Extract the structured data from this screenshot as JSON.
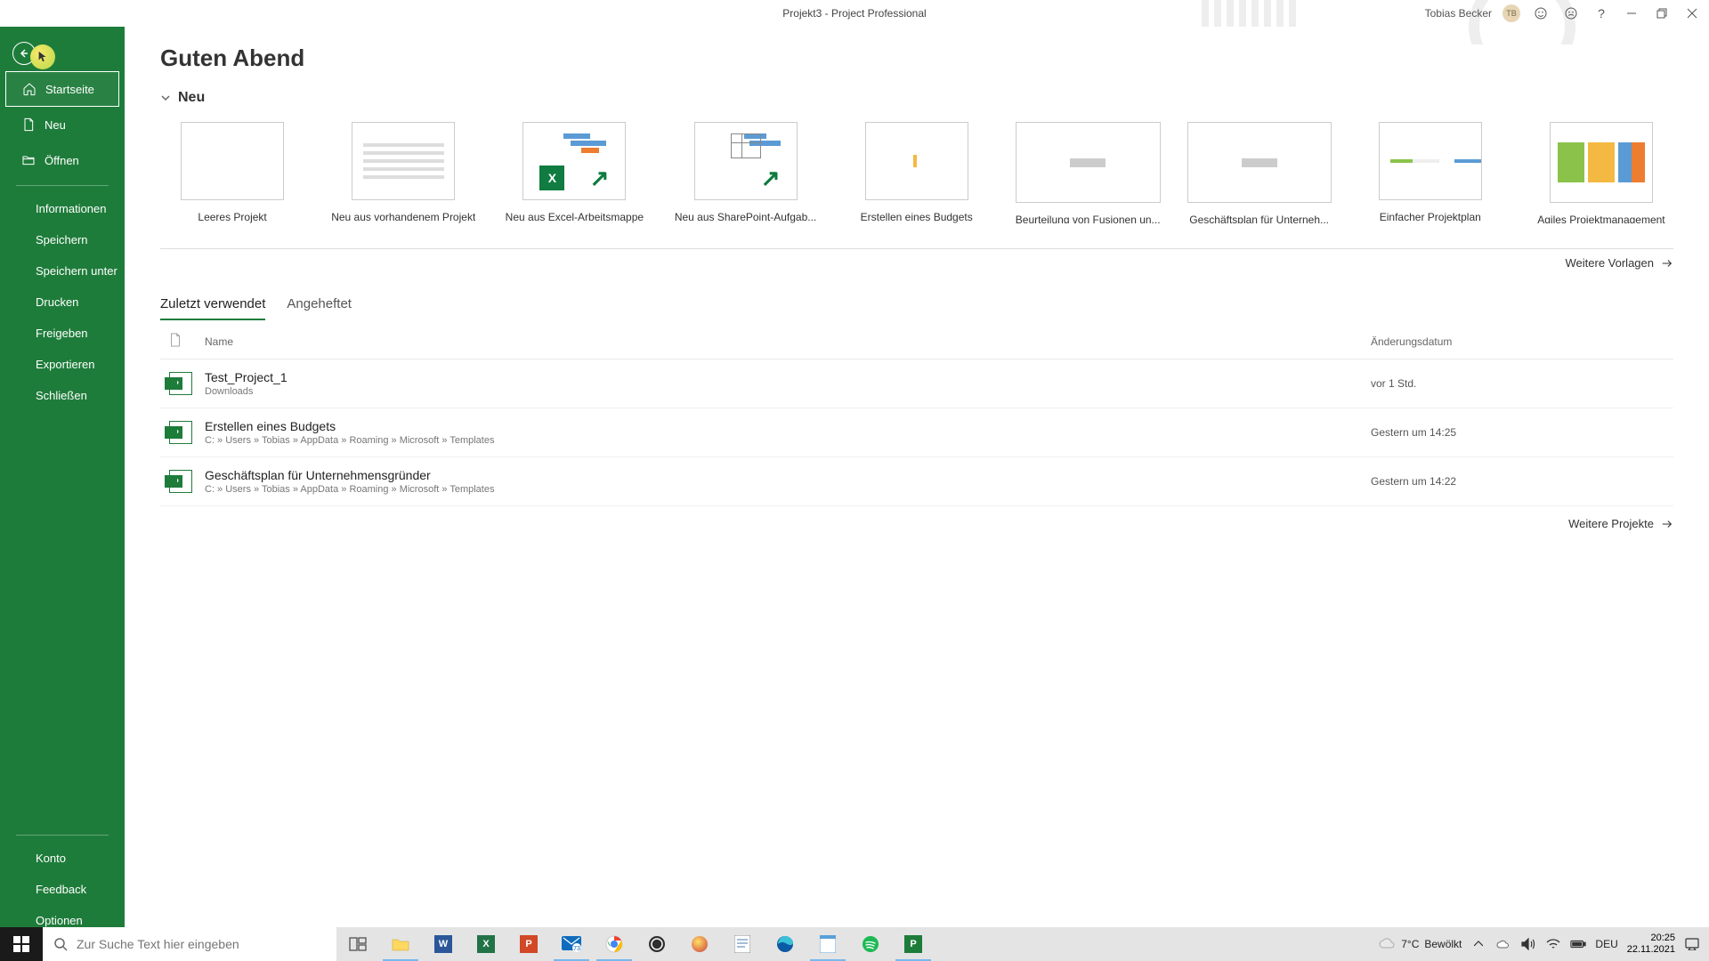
{
  "titlebar": {
    "title": "Projekt3  -  Project Professional",
    "user": "Tobias Becker",
    "user_initials": "TB"
  },
  "sidebar": {
    "home": "Startseite",
    "new": "Neu",
    "open": "Öffnen",
    "info": "Informationen",
    "save": "Speichern",
    "saveas": "Speichern unter",
    "print": "Drucken",
    "share": "Freigeben",
    "export": "Exportieren",
    "close": "Schließen",
    "account": "Konto",
    "feedback": "Feedback",
    "options": "Optionen"
  },
  "main": {
    "greeting": "Guten Abend",
    "new_section": "Neu",
    "more_templates": "Weitere Vorlagen",
    "more_projects": "Weitere Projekte",
    "templates": [
      {
        "label": "Leeres Projekt"
      },
      {
        "label": "Neu aus vorhandenem Projekt"
      },
      {
        "label": "Neu aus Excel-Arbeitsmappe"
      },
      {
        "label": "Neu aus SharePoint-Aufgab..."
      },
      {
        "label": "Erstellen eines Budgets"
      },
      {
        "label": "Beurteilung von Fusionen un..."
      },
      {
        "label": "Geschäftsplan für Unterneh..."
      },
      {
        "label": "Einfacher Projektplan"
      },
      {
        "label": "Agiles Projektmanagement"
      }
    ],
    "tabs": {
      "recent": "Zuletzt verwendet",
      "pinned": "Angeheftet"
    },
    "file_header": {
      "name": "Name",
      "date": "Änderungsdatum"
    },
    "files": [
      {
        "name": "Test_Project_1",
        "path": "Downloads",
        "date": "vor 1 Std."
      },
      {
        "name": "Erstellen eines Budgets",
        "path": "C: » Users » Tobias » AppData » Roaming » Microsoft » Templates",
        "date": "Gestern um 14:25"
      },
      {
        "name": "Geschäftsplan für Unternehmensgründer",
        "path": "C: » Users » Tobias » AppData » Roaming » Microsoft » Templates",
        "date": "Gestern um 14:22"
      }
    ]
  },
  "taskbar": {
    "search_placeholder": "Zur Suche Text hier eingeben",
    "weather_temp": "7°C",
    "weather_desc": "Bewölkt",
    "lang": "DEU",
    "time": "20:25",
    "date": "22.11.2021"
  }
}
